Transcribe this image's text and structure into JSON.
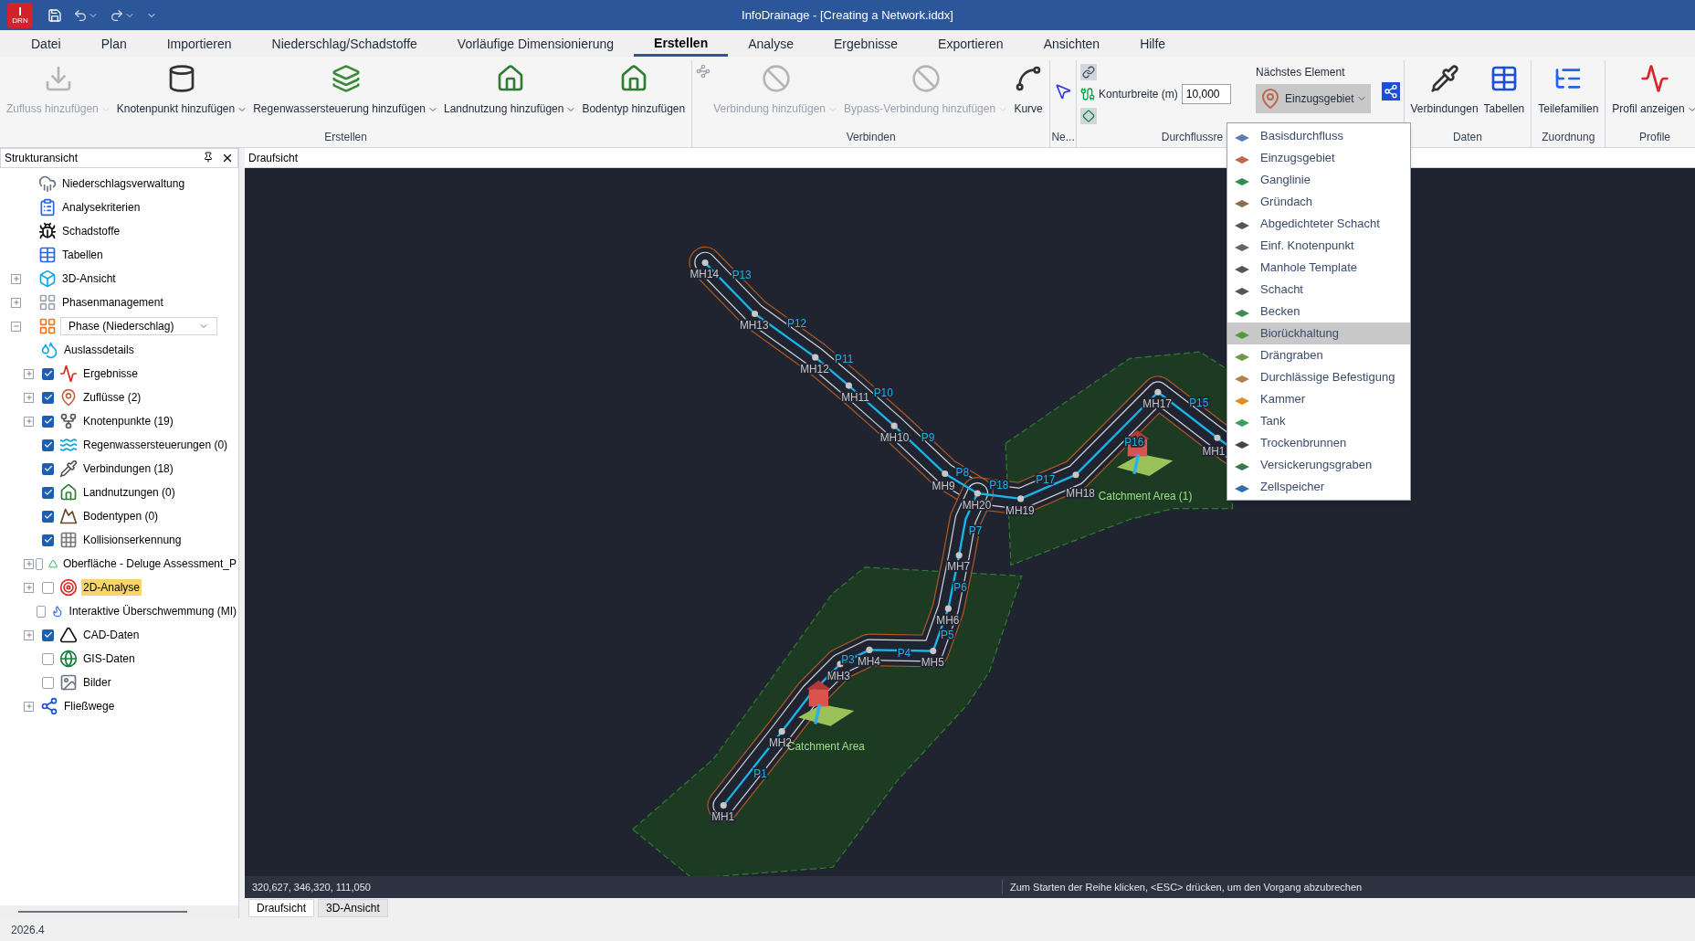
{
  "app": {
    "logo_letter": "I",
    "logo_sub": "DRN",
    "title": "InfoDrainage - [Creating a Network.iddx]"
  },
  "menu_tabs": [
    {
      "label": "Datei",
      "selected": false
    },
    {
      "label": "Plan",
      "selected": false
    },
    {
      "label": "Importieren",
      "selected": false
    },
    {
      "label": "Niederschlag/Schadstoffe",
      "selected": false
    },
    {
      "label": "Vorläufige Dimensionierung",
      "selected": false
    },
    {
      "label": "Erstellen",
      "selected": true
    },
    {
      "label": "Analyse",
      "selected": false
    },
    {
      "label": "Ergebnisse",
      "selected": false
    },
    {
      "label": "Exportieren",
      "selected": false
    },
    {
      "label": "Ansichten",
      "selected": false
    },
    {
      "label": "Hilfe",
      "selected": false
    }
  ],
  "ribbon": {
    "create": {
      "label": "Erstellen",
      "buttons": [
        {
          "label": "Zufluss hinzufügen",
          "disabled": true,
          "dropdown": true
        },
        {
          "label": "Knotenpunkt hinzufügen",
          "disabled": false,
          "dropdown": true
        },
        {
          "label": "Regenwassersteuerung hinzufügen",
          "disabled": false,
          "dropdown": true
        },
        {
          "label": "Landnutzung hinzufügen",
          "disabled": false,
          "dropdown": true
        },
        {
          "label": "Bodentyp hinzufügen",
          "disabled": false,
          "dropdown": false
        }
      ]
    },
    "connect": {
      "label": "Verbinden",
      "buttons": [
        {
          "label": "Verbindung hinzufügen",
          "disabled": true,
          "dropdown": true
        },
        {
          "label": "Bypass-Verbindung hinzufügen",
          "disabled": true,
          "dropdown": true
        },
        {
          "label": "Kurve",
          "disabled": false,
          "dropdown": false
        }
      ]
    },
    "network": {
      "label": "Ne..."
    },
    "flow": {
      "label": "Durchflussre",
      "contour_label": "Konturbreite (m)",
      "contour_value": "10,000",
      "next_label": "Nächstes Element",
      "next_button": {
        "label": "Einzugsgebiet",
        "pressed": true
      }
    },
    "data": {
      "label": "Daten",
      "buttons": [
        {
          "label": "Verbindungen",
          "disabled": false,
          "dropdown": false
        },
        {
          "label": "Tabellen",
          "disabled": false,
          "dropdown": false
        }
      ]
    },
    "assign": {
      "label": "Zuordnung",
      "buttons": [
        {
          "label": "Teilefamilien",
          "disabled": false,
          "dropdown": false
        }
      ]
    },
    "profiles": {
      "label": "Profile",
      "buttons": [
        {
          "label": "Profil anzeigen",
          "disabled": false,
          "dropdown": true
        }
      ]
    }
  },
  "tree": {
    "title": "Strukturansicht",
    "items": [
      {
        "label": "Niederschlagsverwaltung",
        "selected": false
      },
      {
        "label": "Analysekriterien",
        "selected": false
      },
      {
        "label": "Schadstoffe",
        "selected": false
      },
      {
        "label": "Tabellen",
        "selected": false
      },
      {
        "label": "3D-Ansicht",
        "selected": false,
        "expanded": false
      },
      {
        "label": "Phasenmanagement",
        "selected": false,
        "expanded": false
      },
      {
        "kind": "select",
        "value": "Phase (Niederschlag)",
        "selected": false,
        "expanded": true,
        "children": [
          {
            "label": "Auslassdetails",
            "selected": false
          },
          {
            "label": "Ergebnisse",
            "selected": false,
            "expanded": false,
            "checked": true
          },
          {
            "label": "Zuflüsse (2)",
            "selected": false,
            "expanded": false,
            "checked": true
          },
          {
            "label": "Knotenpunkte (19)",
            "selected": false,
            "expanded": false,
            "checked": true
          },
          {
            "label": "Regenwassersteuerungen (0)",
            "selected": false,
            "checked": true
          },
          {
            "label": "Verbindungen (18)",
            "selected": false,
            "checked": true
          },
          {
            "label": "Landnutzungen (0)",
            "selected": false,
            "checked": true
          },
          {
            "label": "Bodentypen (0)",
            "selected": false,
            "checked": true
          },
          {
            "label": "Kollisionserkennung",
            "selected": false,
            "checked": true
          },
          {
            "label": "Oberfläche - Deluge Assessment_P",
            "selected": false,
            "expanded": false,
            "checked": false
          },
          {
            "label": "2D-Analyse",
            "selected": true,
            "expanded": false,
            "checked": false
          },
          {
            "label": "Interaktive Überschwemmung (MI)",
            "selected": false,
            "checked": false
          },
          {
            "label": "CAD-Daten",
            "selected": false,
            "expanded": false,
            "checked": true
          },
          {
            "label": "GIS-Daten",
            "selected": false,
            "checked": false
          },
          {
            "label": "Bilder",
            "selected": false,
            "checked": false
          },
          {
            "label": "Fließwege",
            "selected": false,
            "expanded": false
          }
        ]
      }
    ]
  },
  "view_tab": "Draufsicht",
  "canvas": {
    "nodes": [
      "MH14",
      "MH13",
      "MH12",
      "MH11",
      "MH10",
      "MH9",
      "MH20",
      "MH19",
      "MH18",
      "MH17",
      "MH1",
      "MH7",
      "MH6",
      "MH4",
      "MH5",
      "MH3",
      "MH2",
      "MH1"
    ],
    "pipes": [
      "P13",
      "P12",
      "P11",
      "P10",
      "P9",
      "P8",
      "P18",
      "P17",
      "P16",
      "P15",
      "P7",
      "P6",
      "P5",
      "P4",
      "P3",
      "P1"
    ],
    "catchments": [
      "Catchment Area (1)",
      "Catchment Area"
    ]
  },
  "status": {
    "coords": "320,627, 346,320, 111,050",
    "prompt": "Zum Starten der Reihe klicken, <ESC> drücken, um den Vorgang abzubrechen"
  },
  "bottom_tabs": [
    {
      "label": "Draufsicht",
      "selected": true
    },
    {
      "label": "3D-Ansicht",
      "selected": false
    }
  ],
  "version": "2026.4",
  "menu": [
    {
      "label": "Basisdurchfluss",
      "selected": false,
      "color": "#5b7fb5"
    },
    {
      "label": "Einzugsgebiet",
      "selected": false,
      "color": "#c0674b"
    },
    {
      "label": "Ganglinie",
      "selected": false,
      "color": "#2f8f4e"
    },
    {
      "label": "Gründach",
      "selected": false,
      "color": "#8a6d4a"
    },
    {
      "label": "Abgedichteter Schacht",
      "selected": false,
      "color": "#555555"
    },
    {
      "label": "Einf. Knotenpunkt",
      "selected": false,
      "color": "#666666"
    },
    {
      "label": "Manhole Template",
      "selected": false,
      "color": "#555555"
    },
    {
      "label": "Schacht",
      "selected": false,
      "color": "#555555"
    },
    {
      "label": "Becken",
      "selected": false,
      "color": "#3f8a55"
    },
    {
      "label": "Biorückhaltung",
      "selected": true,
      "color": "#4f9a3a"
    },
    {
      "label": "Drängraben",
      "selected": false,
      "color": "#6a9a4a"
    },
    {
      "label": "Durchlässige Befestigung",
      "selected": false,
      "color": "#b08050"
    },
    {
      "label": "Kammer",
      "selected": false,
      "color": "#e08a20"
    },
    {
      "label": "Tank",
      "selected": false,
      "color": "#3aa060"
    },
    {
      "label": "Trockenbrunnen",
      "selected": false,
      "color": "#444444"
    },
    {
      "label": "Versickerungsgraben",
      "selected": false,
      "color": "#3a7a4a"
    },
    {
      "label": "Zellspeicher",
      "selected": false,
      "color": "#2a70b0"
    }
  ]
}
